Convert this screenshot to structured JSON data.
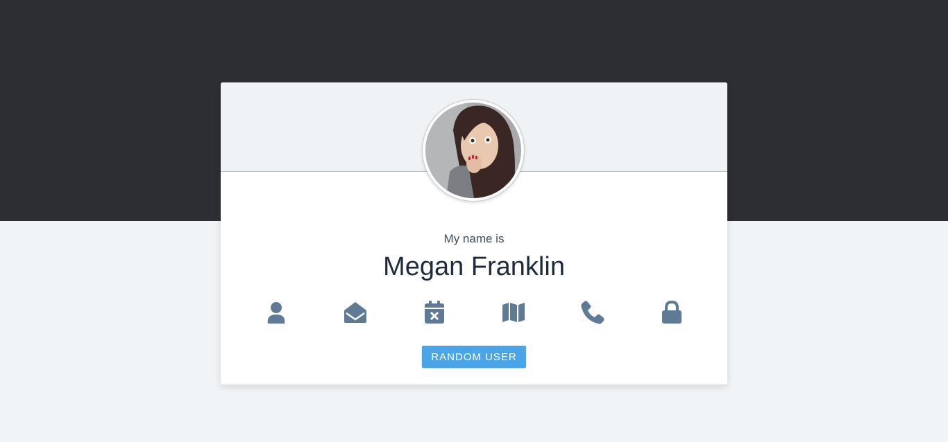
{
  "card": {
    "label": "My name is",
    "name": "Megan Franklin",
    "button_label": "RANDOM USER"
  },
  "icons": [
    "user-icon",
    "envelope-open-icon",
    "calendar-x-icon",
    "map-icon",
    "phone-icon",
    "lock-icon"
  ],
  "colors": {
    "top_band": "#2c2e33",
    "background": "#f0f4f7",
    "icon": "#5e7a94",
    "button": "#4aa5e8"
  }
}
